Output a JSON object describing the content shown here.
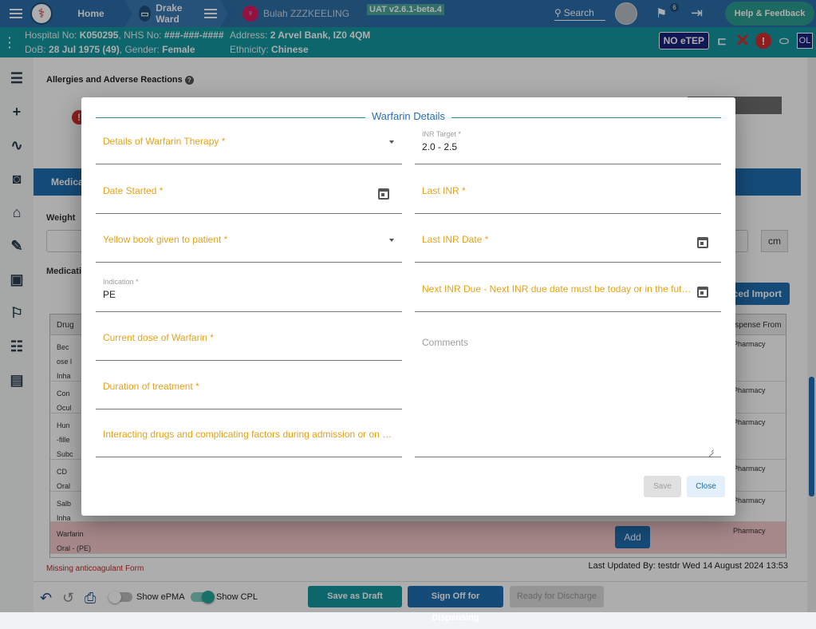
{
  "topbar": {
    "home_label": "Home",
    "ward_label": "Drake Ward",
    "patient_label": "Bulah ZZZKEELING",
    "version": "UAT v2.6.1-beta.4",
    "search_label": "Search",
    "flag_count": "6",
    "help_label": "Help & Feedback"
  },
  "patient_bar": {
    "hospital_no_label": "Hospital No:",
    "hospital_no": "K050295",
    "nhs_no_label": "NHS No:",
    "nhs_no": "###-###-####",
    "dob_label": "DoB:",
    "dob": "28 Jul 1975 (49)",
    "gender_label": "Gender:",
    "gender": "Female",
    "address_label": "Address:",
    "address": "2 Arvel Bank, IZ0 4QM",
    "ethnicity_label": "Ethnicity:",
    "ethnicity": "Chinese",
    "etep_badge": "NO eTEP",
    "ol_badge": "OL"
  },
  "background": {
    "allergies_title": "Allergies and Adverse Reactions",
    "medication_header": "Medica",
    "weight_label": "Weight",
    "weight_unit": "cm",
    "medication_label": "Medicatio",
    "import_label": "ced Import",
    "table_head_drug": "Drug",
    "table_head_dispense": "ispense From",
    "rows": [
      {
        "drug": "Bec\nose l\nInha",
        "dispense": "Pharmacy"
      },
      {
        "drug": "Con\nOcul",
        "dispense": "Pharmacy"
      },
      {
        "drug": "Hun\n-fille\nSubc",
        "dispense": "Pharmacy"
      },
      {
        "drug": "CD\nOral",
        "dispense": "Pharmacy"
      },
      {
        "drug": "Salb\nInha",
        "dispense": "Pharmacy"
      },
      {
        "drug": "Warfarin\nOral - (PE)",
        "dispense": "Pharmacy"
      }
    ],
    "add_label": "Add",
    "missing_text": "Missing anticoagulant Form",
    "last_updated": "Last Updated By: testdr Wed 14 August 2024 13:53",
    "show_epma": "Show ePMA",
    "show_cpl": "Show CPL",
    "save_draft": "Save as Draft",
    "sign_off": "Sign Off for Dispensing",
    "ready_discharge": "Ready for Discharge"
  },
  "dialog": {
    "title": "Warfarin Details",
    "fields": {
      "therapy_details": "Details of Warfarin Therapy *",
      "inr_target_label": "INR Target *",
      "inr_target_value": "2.0 - 2.5",
      "date_started": "Date Started *",
      "last_inr": "Last INR *",
      "yellow_book": "Yellow book given to patient *",
      "last_inr_date": "Last INR Date *",
      "indication_label": "Indication *",
      "indication_value": "PE",
      "next_inr_due": "Next INR Due - Next INR due date must be today or in the future *",
      "current_dose": "Current dose of Warfarin *",
      "comments": "Comments",
      "duration": "Duration of treatment *",
      "interacting_drugs": "Interacting drugs and complicating factors during admission or on discharge *"
    },
    "save_label": "Save",
    "close_label": "Close"
  },
  "colors": {
    "topbar": "#2a6ea8",
    "patient_bar": "#1597a1",
    "field_label": "#e7a21b",
    "dialog_title": "#2b6fb4"
  }
}
